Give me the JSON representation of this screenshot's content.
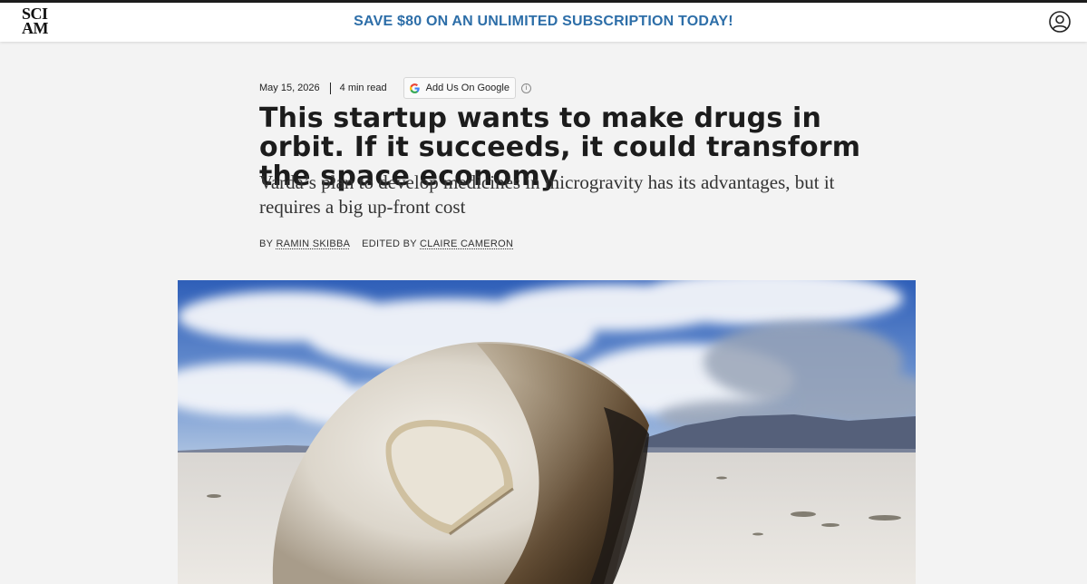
{
  "header": {
    "logo_line1": "SCI",
    "logo_line2": "AM",
    "promo": "SAVE $80 ON AN UNLIMITED SUBSCRIPTION TODAY!",
    "account_icon": "user-circle-icon"
  },
  "article": {
    "date": "May 15, 2026",
    "read_time": "4 min read",
    "google_button": "Add Us On Google",
    "title": "This startup wants to make drugs in orbit. If it succeeds, it could transform the space economy",
    "subtitle": "Varda’s plan to develop medicines in microgravity has its advantages, but it requires a big up-front cost",
    "by_prefix": "BY",
    "author": "RAMIN SKIBBA",
    "edited_prefix": "EDITED BY",
    "editor": "CLAIRE CAMERON"
  },
  "colors": {
    "promo": "#2d6ea8",
    "sky": "#3f6fc4",
    "salt_flat": "#e6e2dc"
  }
}
